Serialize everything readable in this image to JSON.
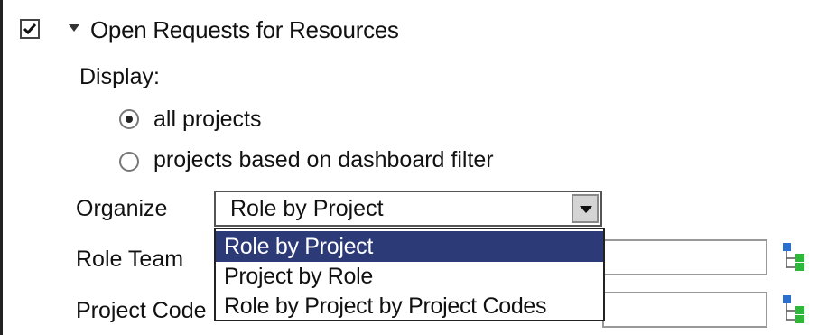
{
  "section": {
    "title": "Open Requests for Resources",
    "enabled": true
  },
  "display": {
    "label": "Display:",
    "options": [
      {
        "label": "all projects",
        "selected": true
      },
      {
        "label": "projects based on dashboard filter",
        "selected": false
      }
    ]
  },
  "organize": {
    "label": "Organize",
    "value": "Role by Project",
    "options": [
      "Role by Project",
      "Project by Role",
      "Role by Project by Project Codes"
    ],
    "highlighted_index": 0
  },
  "role_team": {
    "label": "Role Team",
    "value": ""
  },
  "project_code": {
    "label": "Project Code",
    "value": ""
  },
  "colors": {
    "highlight": "#2c3a78",
    "tree_icon_blue": "#2a6fd0",
    "tree_icon_green": "#2db83a"
  },
  "icons": {
    "checkbox": "check-icon",
    "collapse": "triangle-down-icon",
    "picker": "tree-picker-icon"
  }
}
